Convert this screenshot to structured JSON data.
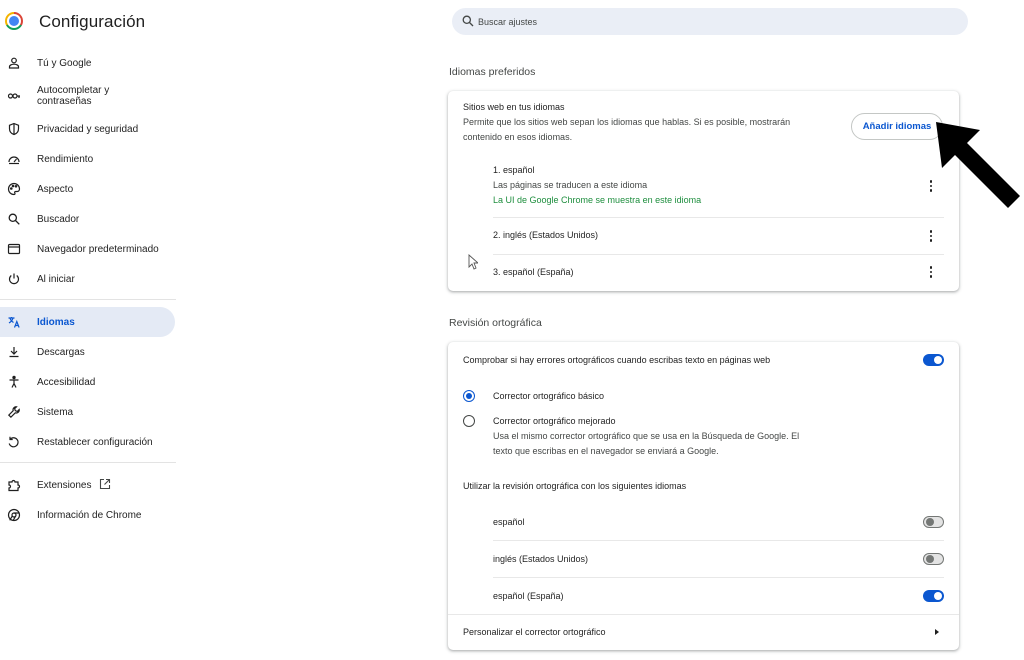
{
  "app": {
    "title": "Configuración"
  },
  "sidebar": {
    "items": [
      {
        "label": "Tú y Google",
        "icon": "person-icon"
      },
      {
        "label": "Autocompletar y\ncontraseñas",
        "icon": "key-icon"
      },
      {
        "label": "Privacidad y seguridad",
        "icon": "shield-icon"
      },
      {
        "label": "Rendimiento",
        "icon": "speedometer-icon"
      },
      {
        "label": "Aspecto",
        "icon": "palette-icon"
      },
      {
        "label": "Buscador",
        "icon": "search-icon"
      },
      {
        "label": "Navegador predeterminado",
        "icon": "browser-icon"
      },
      {
        "label": "Al iniciar",
        "icon": "power-icon"
      },
      {
        "label": "Idiomas",
        "icon": "translate-icon",
        "active": true
      },
      {
        "label": "Descargas",
        "icon": "download-icon"
      },
      {
        "label": "Accesibilidad",
        "icon": "accessibility-icon"
      },
      {
        "label": "Sistema",
        "icon": "wrench-icon"
      },
      {
        "label": "Restablecer configuración",
        "icon": "reset-icon"
      },
      {
        "label": "Extensiones",
        "icon": "puzzle-icon"
      },
      {
        "label": "Información de Chrome",
        "icon": "chrome-icon"
      }
    ]
  },
  "search": {
    "placeholder": "Buscar ajustes"
  },
  "languages": {
    "section_title": "Idiomas preferidos",
    "sites_title": "Sitios web en tus idiomas",
    "sites_desc_line1": "Permite que los sitios web sepan los idiomas que hablas. Si es posible, mostrarán",
    "sites_desc_line2": "contenido en esos idiomas.",
    "add_button": "Añadir idiomas",
    "list": [
      {
        "name": "1. español",
        "sub1": "Las páginas se traducen a este idioma",
        "sub2": "La UI de Google Chrome se muestra en este idioma"
      },
      {
        "name": "2. inglés (Estados Unidos)"
      },
      {
        "name": "3. español (España)"
      }
    ]
  },
  "spellcheck": {
    "section_title": "Revisión ortográfica",
    "main_toggle_label": "Comprobar si hay errores ortográficos cuando escribas texto en páginas web",
    "main_toggle_on": true,
    "basic_label": "Corrector ortográfico básico",
    "enhanced_label": "Corrector ortográfico mejorado",
    "enhanced_desc_line1": "Usa el mismo corrector ortográfico que se usa en la Búsqueda de Google. El",
    "enhanced_desc_line2": "texto que escribas en el navegador se enviará a Google.",
    "languages_header": "Utilizar la revisión ortográfica con los siguientes idiomas",
    "languages": [
      {
        "name": "español",
        "on": false
      },
      {
        "name": "inglés (Estados Unidos)",
        "on": false
      },
      {
        "name": "español (España)",
        "on": true
      }
    ],
    "customize_label": "Personalizar el corrector ortográfico"
  },
  "colors": {
    "accent": "#0b57d0",
    "active_bg": "#e4eaf5",
    "green": "#1e8e3e"
  }
}
